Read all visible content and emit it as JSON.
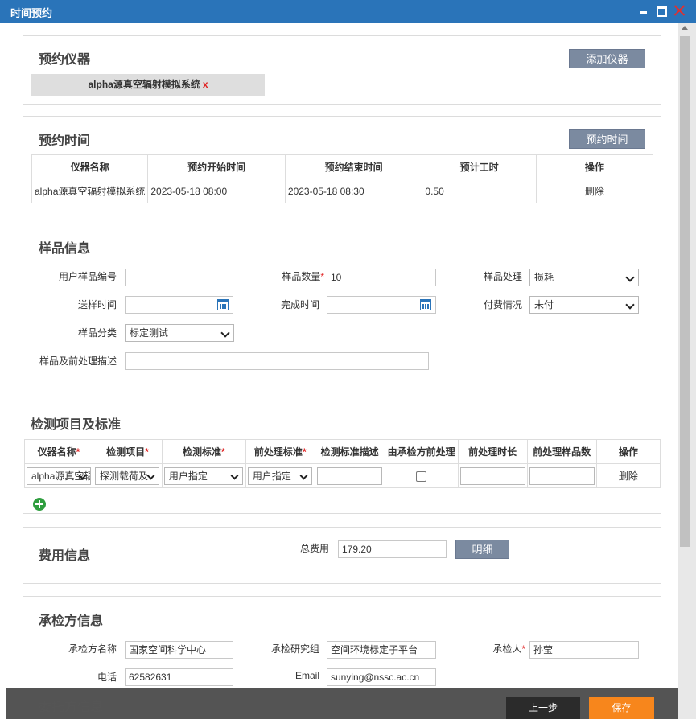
{
  "window": {
    "title": "时间预约"
  },
  "instrument_section": {
    "title": "预约仪器",
    "add_button": "添加仪器",
    "selected_instrument": "alpha源真空辐射模拟系统",
    "remove_mark": "x"
  },
  "time_section": {
    "title": "预约时间",
    "book_button": "预约时间",
    "columns": [
      "仪器名称",
      "预约开始时间",
      "预约结束时间",
      "预计工时",
      "操作"
    ],
    "rows": [
      {
        "instrument": "alpha源真空辐射模拟系统",
        "start": "2023-05-18 08:00",
        "end": "2023-05-18 08:30",
        "hours": "0.50",
        "action": "删除"
      }
    ]
  },
  "sample_section": {
    "title": "样品信息",
    "user_sample_no_label": "用户样品编号",
    "user_sample_no_value": "",
    "quantity_label": "样品数量",
    "required_mark": "*",
    "quantity_value": "10",
    "handling_label": "样品处理",
    "handling_value": "损耗",
    "send_time_label": "送样时间",
    "finish_time_label": "完成时间",
    "payment_label": "付费情况",
    "payment_value": "未付",
    "category_label": "样品分类",
    "category_value": "标定测试",
    "description_label": "样品及前处理描述",
    "description_value": ""
  },
  "test_section": {
    "title": "检测项目及标准",
    "columns": [
      {
        "label": "仪器名称",
        "required": true
      },
      {
        "label": "检测项目",
        "required": true
      },
      {
        "label": "检测标准",
        "required": true
      },
      {
        "label": "前处理标准",
        "required": true
      },
      {
        "label": "检测标准描述",
        "required": false
      },
      {
        "label": "由承检方前处理",
        "required": false
      },
      {
        "label": "前处理时长",
        "required": false
      },
      {
        "label": "前处理样品数",
        "required": false
      },
      {
        "label": "操作",
        "required": false
      }
    ],
    "row": {
      "instrument": "alpha源真空辐射模拟系统",
      "item": "探测载荷及",
      "standard": "用户指定",
      "pre_standard": "用户指定",
      "action": "删除"
    }
  },
  "fee_section": {
    "title": "费用信息",
    "total_label": "总费用",
    "total_value": "179.20",
    "detail_button": "明细"
  },
  "inspector_section": {
    "title": "承检方信息",
    "org_label": "承检方名称",
    "org_value": "国家空间科学中心",
    "group_label": "承检研究组",
    "group_value": "空间环境标定子平台",
    "person_label": "承检人",
    "person_value": "孙莹",
    "phone_label": "电话",
    "phone_value": "62582631",
    "email_label": "Email",
    "email_value": "sunying@nssc.ac.cn"
  },
  "client_section": {
    "title": "委托方信息"
  },
  "footer": {
    "prev_button": "上一步",
    "save_button": "保存"
  }
}
